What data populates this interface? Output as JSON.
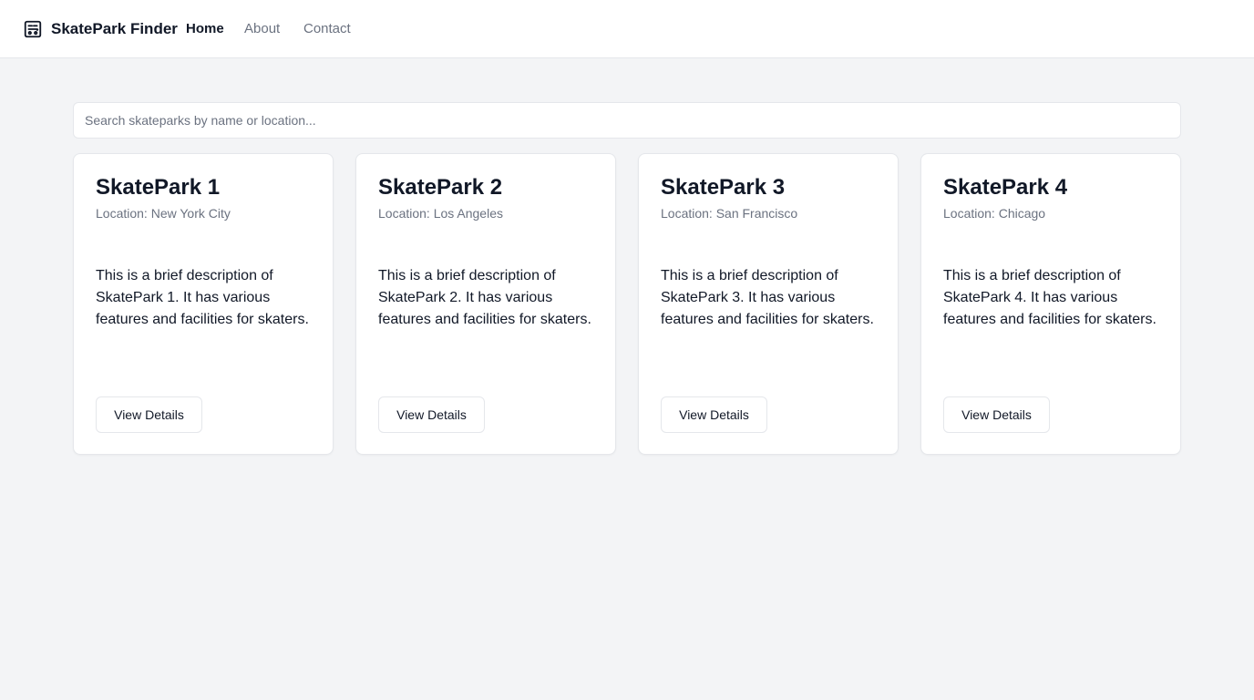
{
  "header": {
    "brand": "SkatePark Finder",
    "logo_icon": "skateboard-icon",
    "nav": [
      {
        "label": "Home",
        "active": true
      },
      {
        "label": "About",
        "active": false
      },
      {
        "label": "Contact",
        "active": false
      }
    ]
  },
  "search": {
    "placeholder": "Search skateparks by name or location...",
    "value": ""
  },
  "parks": [
    {
      "name": "SkatePark 1",
      "location": "Location: New York City",
      "description": "This is a brief description of SkatePark 1. It has various features and facilities for skaters.",
      "button_label": "View Details"
    },
    {
      "name": "SkatePark 2",
      "location": "Location: Los Angeles",
      "description": "This is a brief description of SkatePark 2. It has various features and facilities for skaters.",
      "button_label": "View Details"
    },
    {
      "name": "SkatePark 3",
      "location": "Location: San Francisco",
      "description": "This is a brief description of SkatePark 3. It has various features and facilities for skaters.",
      "button_label": "View Details"
    },
    {
      "name": "SkatePark 4",
      "location": "Location: Chicago",
      "description": "This is a brief description of SkatePark 4. It has various features and facilities for skaters.",
      "button_label": "View Details"
    }
  ],
  "colors": {
    "background": "#f3f4f6",
    "card": "#ffffff",
    "text": "#111827",
    "muted": "#6b7280",
    "border": "#e5e7eb"
  }
}
